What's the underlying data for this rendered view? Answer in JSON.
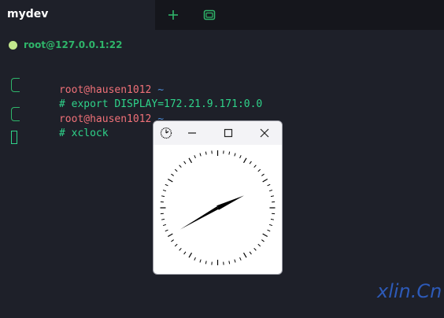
{
  "tab": {
    "title": "mydev",
    "new_tab_icon": "plus-icon",
    "split_icon": "window-icon"
  },
  "session": {
    "address": "root@127.0.0.1:22",
    "status_color": "#c3e88d"
  },
  "terminal": {
    "lines": [
      {
        "user": "root@hausen1012",
        "dir": " ~"
      },
      {
        "command": "# export DISPLAY=172.21.9.171:0.0"
      },
      {
        "user": "root@hausen1012",
        "dir": " ~"
      },
      {
        "command": "# xclock"
      }
    ]
  },
  "xclock": {
    "app_icon": "clock-icon",
    "minimize_icon": "minimize-icon",
    "maximize_icon": "maximize-icon",
    "close_icon": "close-icon",
    "time": {
      "hour": 2,
      "minute": 10
    }
  },
  "watermark": "xlin.Cn",
  "colors": {
    "background": "#1e2029",
    "tabbar": "#15161c",
    "accent_green": "#2fb56a",
    "user_red": "#f07178",
    "path_blue": "#4d8fdc"
  }
}
